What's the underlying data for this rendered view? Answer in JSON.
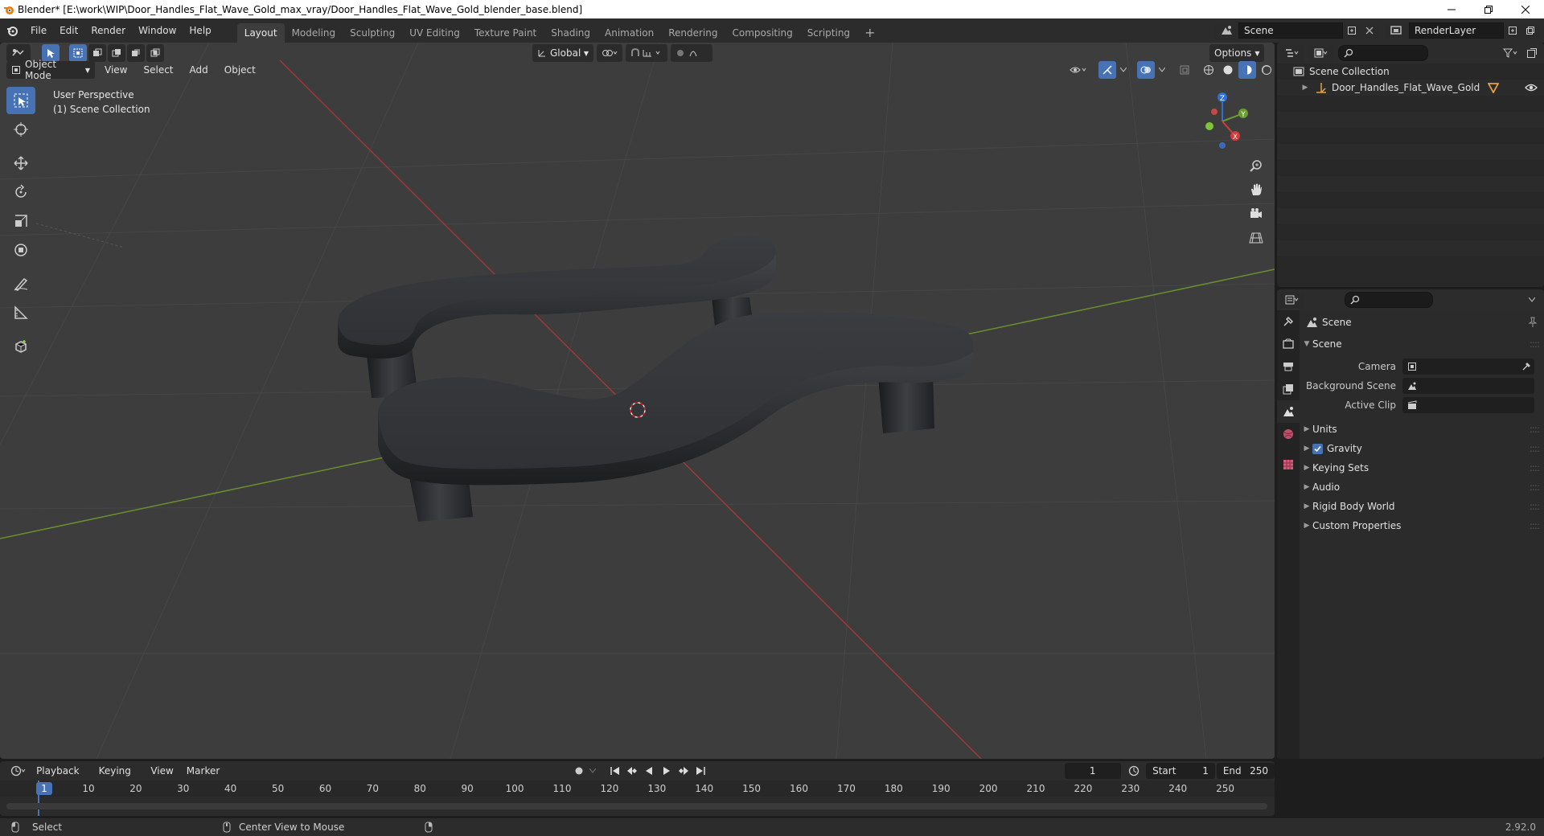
{
  "window": {
    "title": "Blender* [E:\\work\\WIP\\Door_Handles_Flat_Wave_Gold_max_vray/Door_Handles_Flat_Wave_Gold_blender_base.blend]"
  },
  "menus": [
    "File",
    "Edit",
    "Render",
    "Window",
    "Help"
  ],
  "workspaces": [
    {
      "label": "Layout",
      "active": true
    },
    {
      "label": "Modeling",
      "active": false
    },
    {
      "label": "Sculpting",
      "active": false
    },
    {
      "label": "UV Editing",
      "active": false
    },
    {
      "label": "Texture Paint",
      "active": false
    },
    {
      "label": "Shading",
      "active": false
    },
    {
      "label": "Animation",
      "active": false
    },
    {
      "label": "Rendering",
      "active": false
    },
    {
      "label": "Compositing",
      "active": false
    },
    {
      "label": "Scripting",
      "active": false
    }
  ],
  "topbar": {
    "add_workspace": "+",
    "scene": "Scene",
    "view_layer": "RenderLayer"
  },
  "viewport": {
    "transform_orientation": "Global",
    "options": "Options",
    "mode": "Object Mode",
    "menus": [
      "View",
      "Select",
      "Add",
      "Object"
    ],
    "overlay_line1": "User Perspective",
    "overlay_line2": "(1) Scene Collection",
    "gizmo": {
      "z": "Z",
      "y": "Y",
      "x": "X"
    }
  },
  "outliner": {
    "root": "Scene Collection",
    "items": [
      {
        "label": "Door_Handles_Flat_Wave_Gold"
      }
    ]
  },
  "properties": {
    "context": "Scene",
    "panel": "Scene",
    "fields": [
      {
        "label": "Camera"
      },
      {
        "label": "Background Scene"
      },
      {
        "label": "Active Clip"
      }
    ],
    "subpanels": [
      {
        "label": "Units",
        "checkbox": false
      },
      {
        "label": "Gravity",
        "checkbox": true,
        "checked": true
      },
      {
        "label": "Keying Sets",
        "checkbox": false
      },
      {
        "label": "Audio",
        "checkbox": false
      },
      {
        "label": "Rigid Body World",
        "checkbox": false
      },
      {
        "label": "Custom Properties",
        "checkbox": false
      }
    ]
  },
  "timeline": {
    "menus": [
      "Playback",
      "Keying",
      "View",
      "Marker"
    ],
    "current_frame": "1",
    "start_label": "Start",
    "start": "1",
    "end_label": "End",
    "end": "250",
    "ticks": [
      "10",
      "20",
      "30",
      "40",
      "50",
      "60",
      "70",
      "80",
      "90",
      "100",
      "110",
      "120",
      "130",
      "140",
      "150",
      "160",
      "170",
      "180",
      "190",
      "200",
      "210",
      "220",
      "230",
      "240",
      "250"
    ],
    "playhead_label": "1"
  },
  "statusbar": {
    "left": "Select",
    "middle": "Center View to Mouse",
    "version": "2.92.0"
  }
}
